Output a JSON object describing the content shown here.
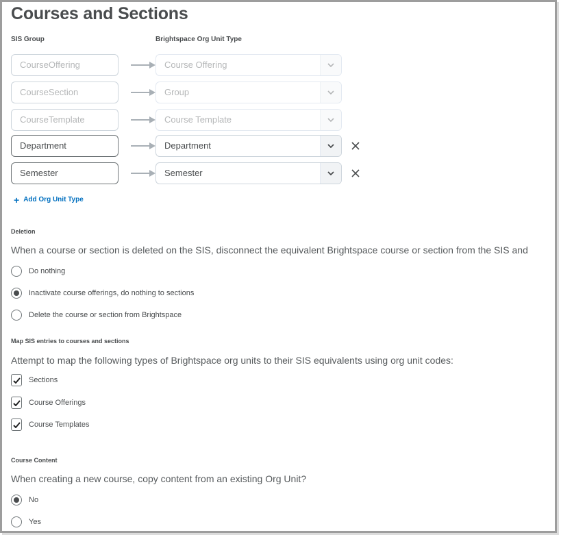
{
  "page": {
    "title": "Courses and Sections"
  },
  "mapping": {
    "sis_group_label": "SIS Group",
    "org_unit_type_label": "Brightspace Org Unit Type",
    "rows": [
      {
        "sis_group": "CourseOffering",
        "org_unit_type": "Course Offering",
        "editable": false
      },
      {
        "sis_group": "CourseSection",
        "org_unit_type": "Group",
        "editable": false
      },
      {
        "sis_group": "CourseTemplate",
        "org_unit_type": "Course Template",
        "editable": false
      },
      {
        "sis_group": "Department",
        "org_unit_type": "Department",
        "editable": true
      },
      {
        "sis_group": "Semester",
        "org_unit_type": "Semester",
        "editable": true
      }
    ],
    "add_label": "Add Org Unit Type",
    "add_icon": "plus-icon",
    "remove_icon": "close-icon",
    "arrow_icon": "arrow-right-icon",
    "chevron_icon": "chevron-down-icon"
  },
  "deletion": {
    "label": "Deletion",
    "description": "When a course or section is deleted on the SIS, disconnect the equivalent Brightspace course or section from the SIS and",
    "options": [
      {
        "label": "Do nothing",
        "selected": false
      },
      {
        "label": "Inactivate course offerings, do nothing to sections",
        "selected": true
      },
      {
        "label": "Delete the course or section from Brightspace",
        "selected": false
      }
    ]
  },
  "map_sis": {
    "label": "Map SIS entries to courses and sections",
    "description": "Attempt to map the following types of Brightspace org units to their SIS equivalents using org unit codes:",
    "options": [
      {
        "label": "Sections",
        "checked": true
      },
      {
        "label": "Course Offerings",
        "checked": true
      },
      {
        "label": "Course Templates",
        "checked": true
      }
    ]
  },
  "course_content": {
    "label": "Course Content",
    "description": "When creating a new course, copy content from an existing Org Unit?",
    "options": [
      {
        "label": "No",
        "selected": true
      },
      {
        "label": "Yes",
        "selected": false
      }
    ]
  },
  "colors": {
    "accent": "#006fbf",
    "text": "#494c4e",
    "disabled_text": "#b5b7b8"
  }
}
